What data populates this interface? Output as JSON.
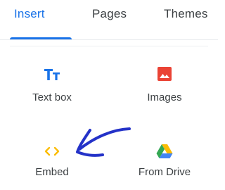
{
  "tabs": [
    {
      "label": "Insert",
      "active": true
    },
    {
      "label": "Pages",
      "active": false
    },
    {
      "label": "Themes",
      "active": false
    }
  ],
  "tiles": [
    {
      "label": "Text box",
      "icon": "text-box-icon",
      "color": "#1a73e8"
    },
    {
      "label": "Images",
      "icon": "image-icon",
      "color": "#ea4335"
    },
    {
      "label": "Embed",
      "icon": "embed-code-icon",
      "color": "#fbbc04"
    },
    {
      "label": "From Drive",
      "icon": "google-drive-icon",
      "color": "#34a853"
    }
  ],
  "colors": {
    "accent": "#1a73e8",
    "annotation_arrow": "#2432c8"
  }
}
